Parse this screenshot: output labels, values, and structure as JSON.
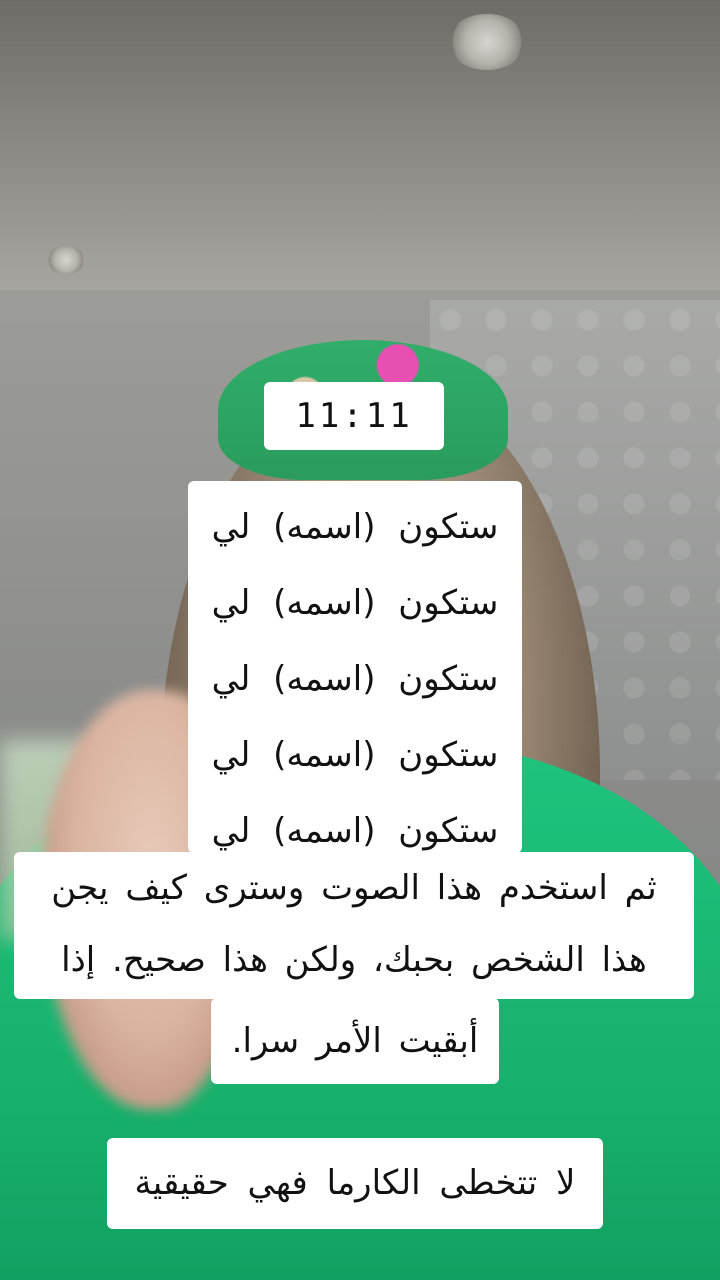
{
  "clock": {
    "time": "11:11"
  },
  "repeated_lines": [
    "ستكون (اسمه) لي",
    "ستكون (اسمه) لي",
    "ستكون (اسمه) لي",
    "ستكون (اسمه) لي",
    "ستكون (اسمه) لي"
  ],
  "caption": {
    "line1": "ثم استخدم هذا الصوت وسترى كيف يجن",
    "line2": "هذا الشخص بحبك، ولكن هذا صحيح. إذا",
    "line3": "أبقيت الأمر سرا."
  },
  "footer": {
    "text": "لا تتخطى الكارما فهي حقيقية"
  },
  "colors": {
    "shirt": "#17b06c",
    "caption_bg": "#ffffff",
    "text": "#111111"
  }
}
